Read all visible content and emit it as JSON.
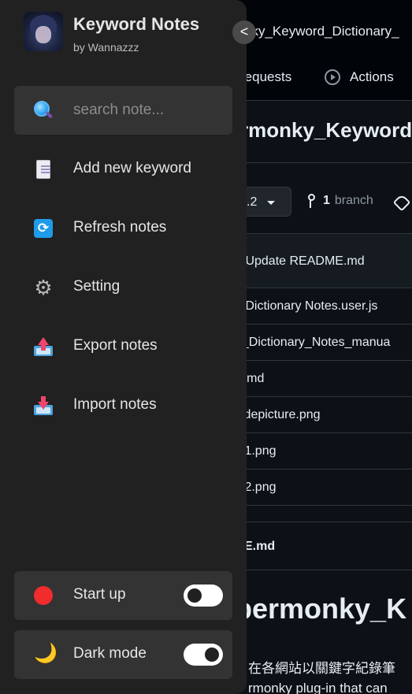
{
  "background": {
    "repo_path": "nky_Keyword_Dictionary_",
    "nav": {
      "pulls": "requests",
      "actions": "Actions"
    },
    "repo_title": "rmonky_Keyword_D",
    "branch_button": ".2",
    "branches": {
      "count": "1",
      "label": "branch"
    },
    "commit": "z Update README.md",
    "files": [
      "d Dictionary Notes.user.js",
      "d_Dictionary_Notes_manua",
      "E.md",
      "sidepicture.png",
      "ip1.png",
      "ip2.png"
    ],
    "readme_header": "E.md",
    "readme_title": "permonky_K",
    "readme_lines": [
      "在各網站以關鍵字紀錄筆",
      "rmonky plug-in that can"
    ]
  },
  "panel": {
    "title": "Keyword Notes",
    "author": "by Wannazzz",
    "collapse_glyph": "<",
    "search": {
      "placeholder": "search note..."
    },
    "menu": [
      {
        "label": "Add new keyword",
        "icon": "document-icon"
      },
      {
        "label": "Refresh notes",
        "icon": "refresh-icon"
      },
      {
        "label": "Setting",
        "icon": "gear-icon"
      },
      {
        "label": "Export notes",
        "icon": "export-icon"
      },
      {
        "label": "Import notes",
        "icon": "import-icon"
      }
    ],
    "toggles": [
      {
        "label": "Start up",
        "icon": "red-circle-icon",
        "state": "off"
      },
      {
        "label": "Dark mode",
        "icon": "moon-icon",
        "state": "on"
      }
    ]
  },
  "colors": {
    "panel_bg": "#212121",
    "field_bg": "#333333",
    "page_bg": "#0d1117"
  }
}
